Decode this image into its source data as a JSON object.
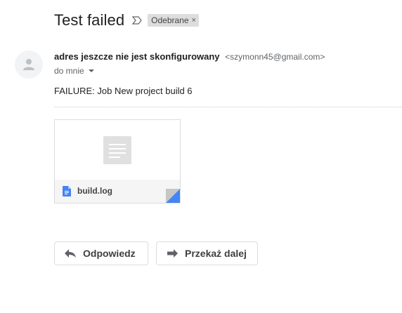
{
  "email": {
    "subject": "Test failed",
    "label": "Odebrane",
    "label_remove": "×",
    "sender_name": "adres jeszcze nie jest skonfigurowany",
    "sender_email": "<szymonn45@gmail.com>",
    "to": "do mnie",
    "body": "FAILURE: Job New project build 6"
  },
  "attachment": {
    "filename": "build.log",
    "icon": "google-docs-icon"
  },
  "actions": {
    "reply_label": "Odpowiedz",
    "forward_label": "Przekaż dalej"
  },
  "colors": {
    "docs_blue": "#4285f4",
    "chip_bg": "#dddddd"
  }
}
